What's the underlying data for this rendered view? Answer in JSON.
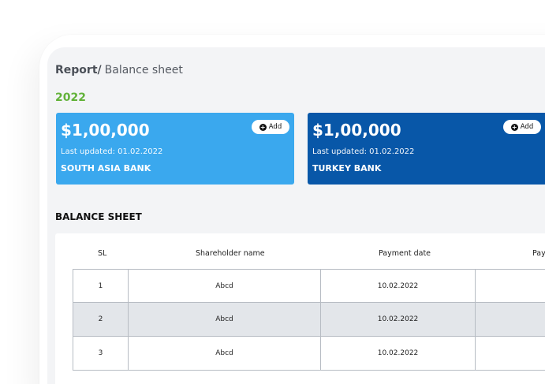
{
  "breadcrumb": {
    "root": "Report",
    "separator": "/",
    "current": "Balance sheet"
  },
  "year": "2022",
  "cards": [
    {
      "amount": "$1,00,000",
      "updated": "Last updated: 01.02.2022",
      "bank": "SOUTH ASIA BANK",
      "add_label": "Add",
      "color": "#3aa8ee"
    },
    {
      "amount": "$1,00,000",
      "updated": "Last updated: 01.02.2022",
      "bank": "TURKEY BANK",
      "add_label": "Add",
      "color": "#0857a8"
    }
  ],
  "balance_sheet": {
    "title": "BALANCE SHEET",
    "columns": [
      "SL",
      "Shareholder name",
      "Payment date",
      "Pay"
    ],
    "rows": [
      {
        "sl": "1",
        "name": "Abcd",
        "date": "10.02.2022",
        "pay": ""
      },
      {
        "sl": "2",
        "name": "Abcd",
        "date": "10.02.2022",
        "pay": ""
      },
      {
        "sl": "3",
        "name": "Abcd",
        "date": "10.02.2022",
        "pay": ""
      }
    ]
  },
  "colors": {
    "accent_green": "#62b23a",
    "row_alt": "#e3e6ea",
    "background": "#f3f4f6"
  }
}
